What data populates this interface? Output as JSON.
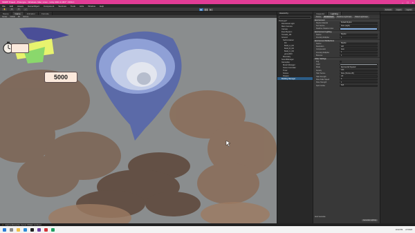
{
  "window": {
    "title": "SMMP Project - Protorype - Windows, Mac, Linux - Unity 2021.3.16f1* <DX11>"
  },
  "menu": [
    "File",
    "Edit",
    "Assets",
    "GameObject",
    "Component",
    "Services",
    "Tools",
    "Jobs",
    "Window",
    "Help"
  ],
  "toolbar": {
    "account": "Account",
    "layers": "Layers",
    "layout": "Layout"
  },
  "scene": {
    "tabs": [
      "Scene",
      "Game",
      "Animator",
      "Console"
    ],
    "toolbar_items": [
      "Center",
      "Global",
      "2D",
      "Gizmos"
    ]
  },
  "hud": {
    "score": "5000"
  },
  "hierarchy": {
    "tab": "Hierarchy",
    "items": [
      "Protorype*",
      "Directional Light",
      "Main Camera",
      "Canvas",
      "EventSystem",
      "Tornado_Fill",
      "Ground",
      "SubContainer",
      "Fill",
      "Build_A_Fill",
      "Build_B_Fill",
      "Build_C_Fill",
      "groundFill",
      "Boundary",
      "SoundManager",
      "Gameplay",
      "Music Manager",
      "Score Controller",
      "Timer",
      "Scores",
      "Powers",
      "Building Manager"
    ]
  },
  "inspector": {
    "tabs": [
      "Inspector",
      "Lighting"
    ],
    "subtabs": [
      "Scene",
      "Environment",
      "Realtime Lightmaps",
      "Baked Lightmaps"
    ],
    "sections": [
      {
        "title": "Environment",
        "rows": [
          {
            "label": "Skybox Material",
            "value": "Default-Skybox"
          },
          {
            "label": "Sun Source",
            "value": "None (Light)"
          },
          {
            "label": "Realtime Shadow Color",
            "value": ""
          }
        ]
      },
      {
        "title": "Environment Lighting",
        "rows": [
          {
            "label": "Source",
            "value": "Skybox"
          },
          {
            "label": "Intensity Multiplier",
            "value": "1"
          }
        ]
      },
      {
        "title": "Environment Reflections",
        "rows": [
          {
            "label": "Source",
            "value": "Skybox"
          },
          {
            "label": "Resolution",
            "value": "128"
          },
          {
            "label": "Compression",
            "value": "Auto"
          },
          {
            "label": "Intensity Multiplier",
            "value": "1"
          },
          {
            "label": "Bounces",
            "value": "1"
          }
        ]
      },
      {
        "title": "Other Settings",
        "rows": [
          {
            "label": "Fog",
            "value": ""
          },
          {
            "label": "Color",
            "value": ""
          },
          {
            "label": "Mode",
            "value": "Exponential Squared"
          },
          {
            "label": "Density",
            "value": "0.01"
          },
          {
            "label": "Halo Texture",
            "value": "None (Texture 2D)"
          },
          {
            "label": "Halo Strength",
            "value": "0.5"
          },
          {
            "label": "Flare Fade Speed",
            "value": "3"
          },
          {
            "label": "Flare Strength",
            "value": "1"
          },
          {
            "label": "Spot Cookie",
            "value": "Soft"
          }
        ]
      }
    ],
    "footer": [
      "Auto Generate",
      "Generate Lighting"
    ]
  },
  "status": {
    "text": "ArgumentException: Kernel 'CSMain' not found"
  },
  "taskbar": {
    "time": "10:42 PM",
    "date": "2/7/2023"
  },
  "colors": {
    "title_bar": "#e23c96",
    "tornado": "#6b7bbf",
    "dust": "#8a6a52"
  }
}
